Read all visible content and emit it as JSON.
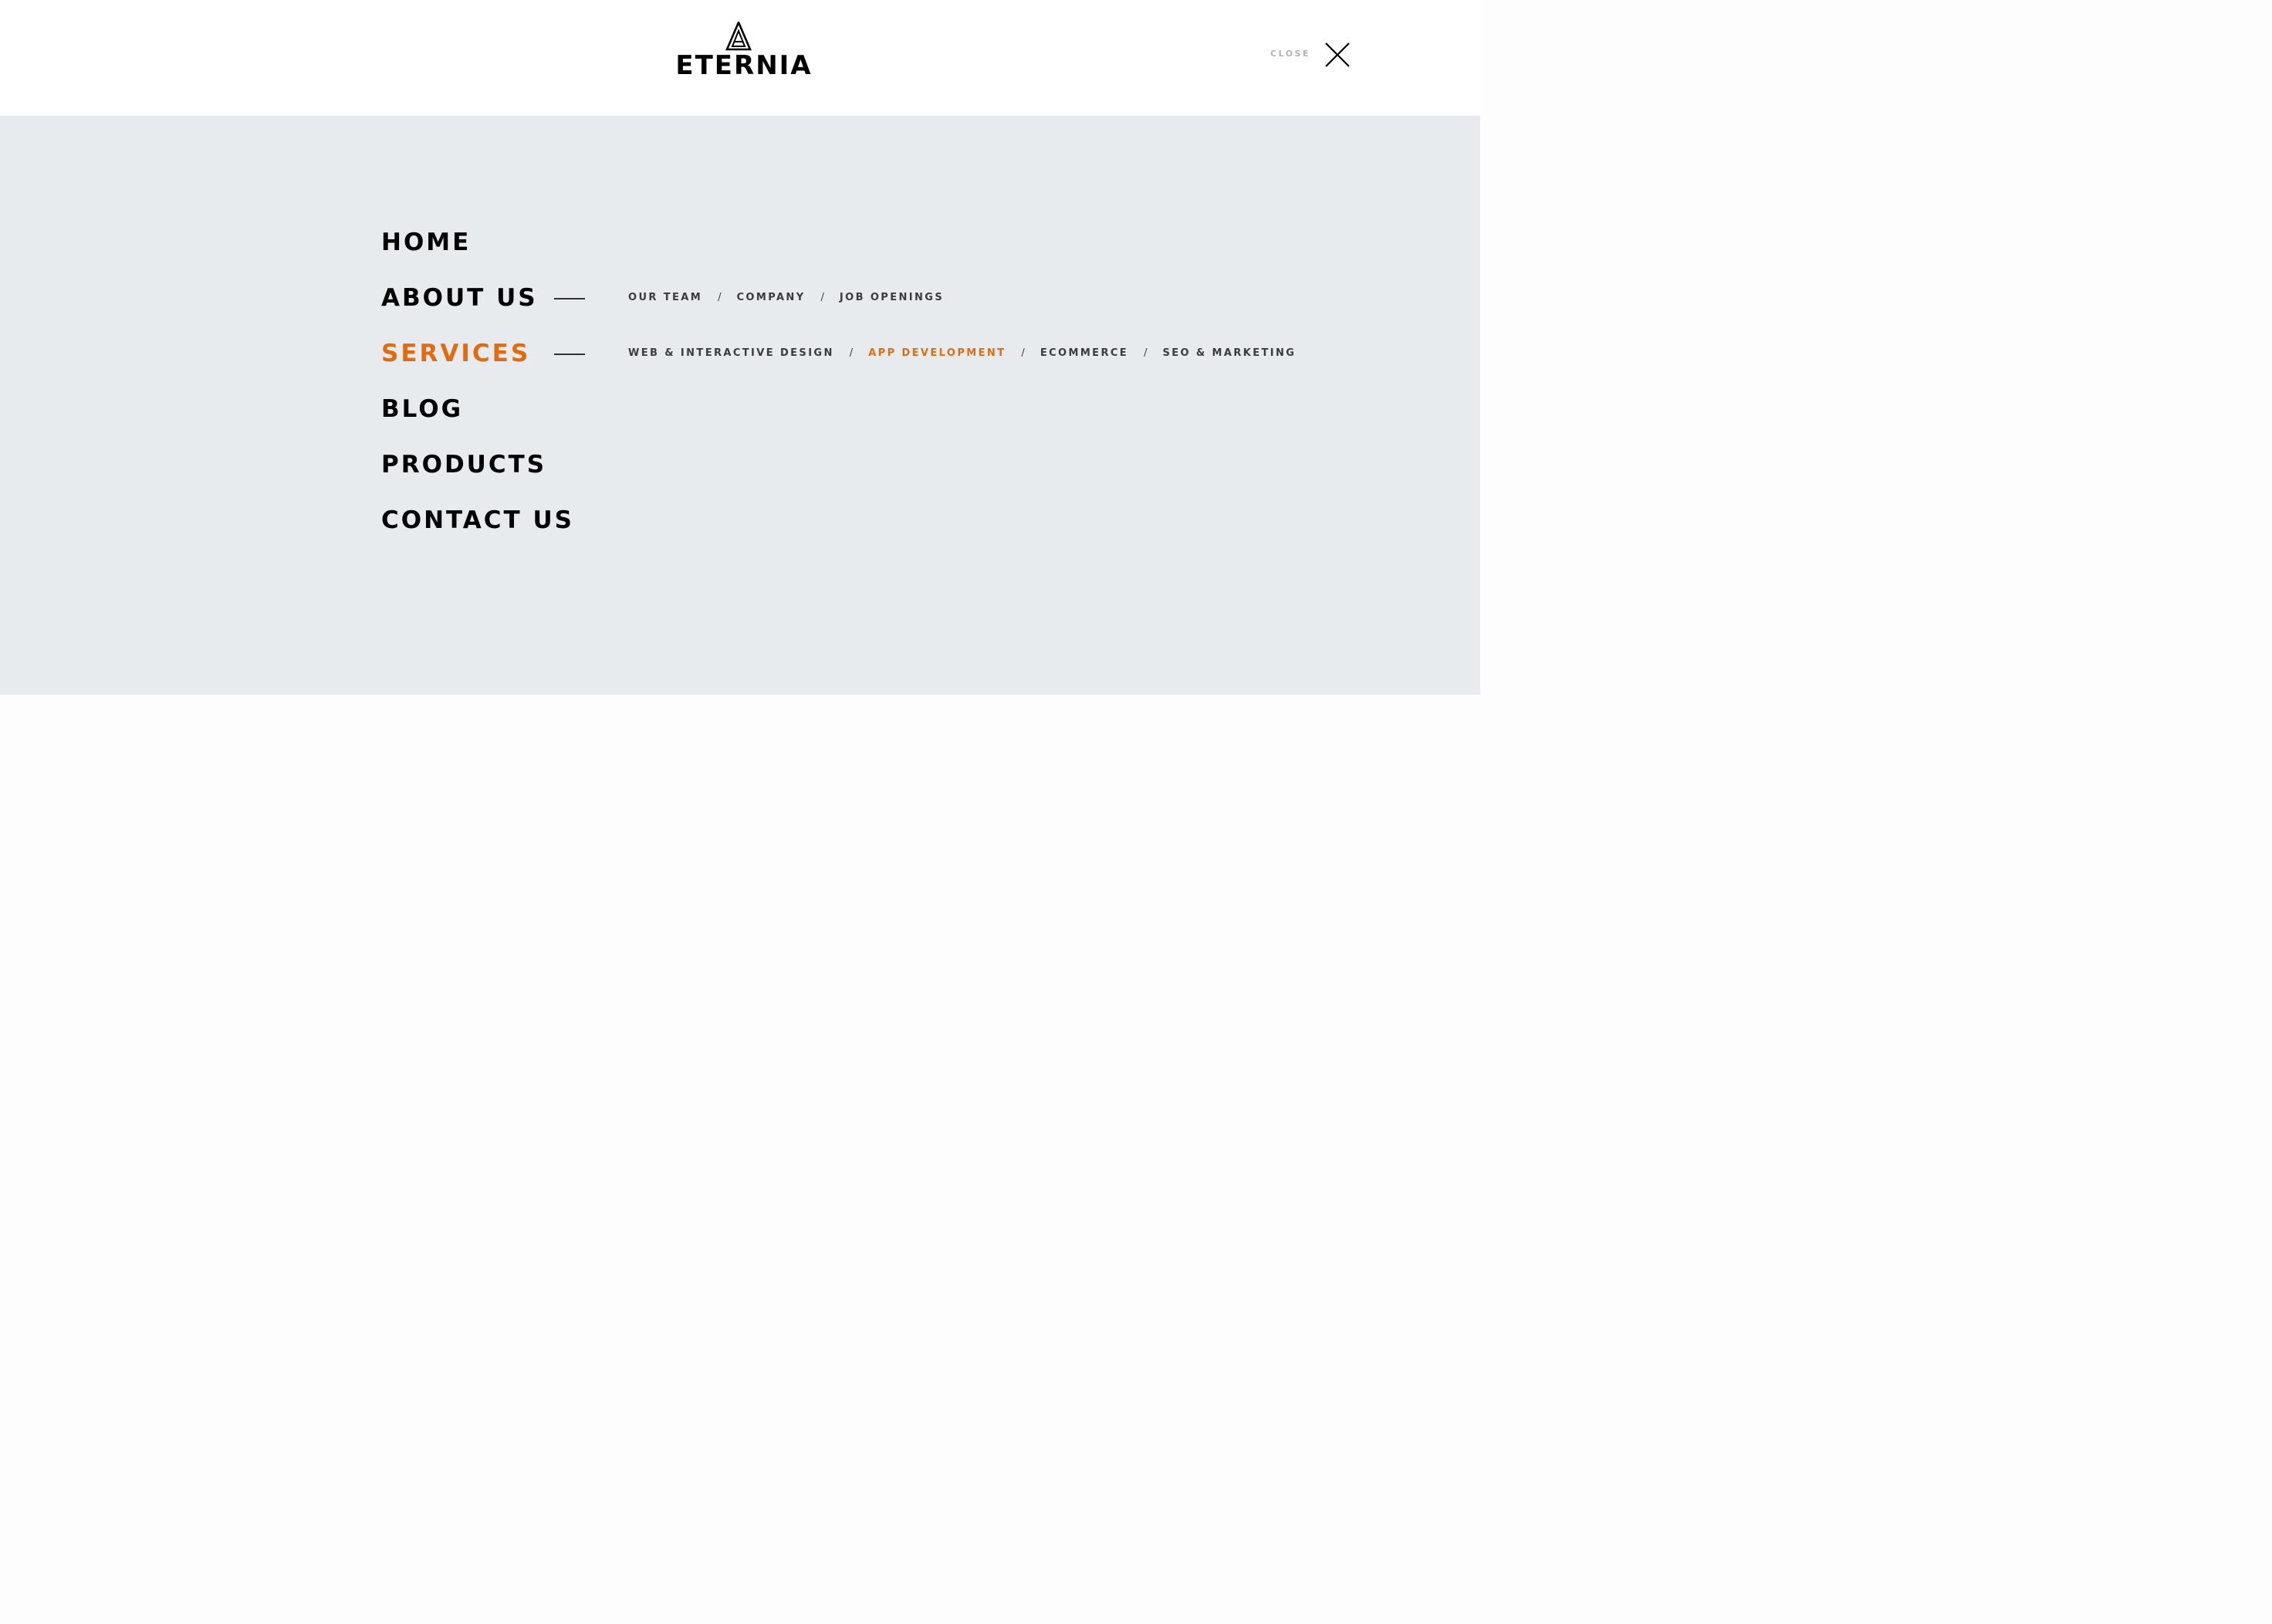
{
  "brand": {
    "name": "ETERNIA",
    "accent_color": "#e06b10",
    "panel_color": "#e8ebee"
  },
  "header": {
    "close_label": "CLOSE",
    "close_icon": "close-icon"
  },
  "nav": {
    "items": [
      {
        "label": "HOME",
        "active": false
      },
      {
        "label": "ABOUT US",
        "active": false,
        "subitems": [
          {
            "label": "OUR TEAM",
            "active": false
          },
          {
            "label": "COMPANY",
            "active": false
          },
          {
            "label": "JOB OPENINGS",
            "active": false
          }
        ]
      },
      {
        "label": "SERVICES",
        "active": true,
        "subitems": [
          {
            "label": "WEB & INTERACTIVE DESIGN",
            "active": false
          },
          {
            "label": "APP DEVELOPMENT",
            "active": true
          },
          {
            "label": "ECOMMERCE",
            "active": false
          },
          {
            "label": "SEO & MARKETING",
            "active": false
          }
        ]
      },
      {
        "label": "BLOG",
        "active": false
      },
      {
        "label": "PRODUCTS",
        "active": false
      },
      {
        "label": "CONTACT US",
        "active": false
      }
    ],
    "separator": "/"
  }
}
